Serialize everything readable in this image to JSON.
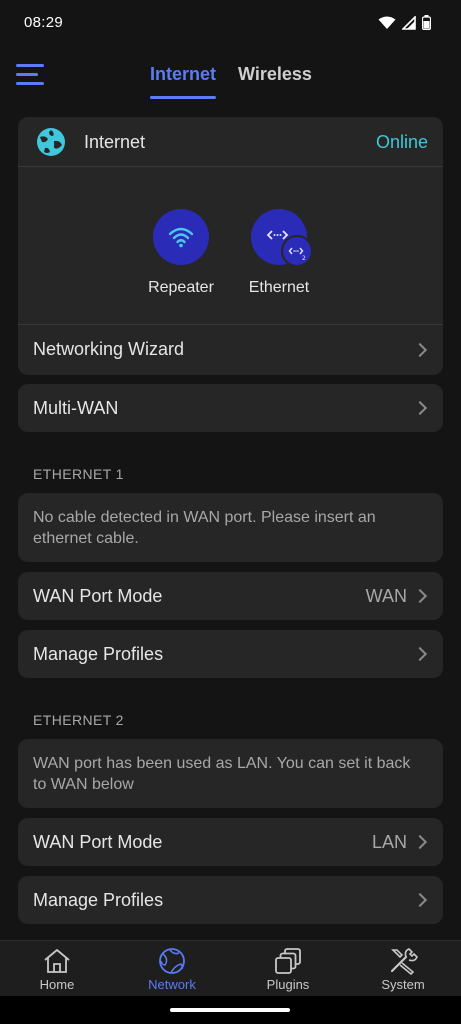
{
  "status_bar": {
    "time": "08:29",
    "icons": [
      "wifi-icon",
      "cellular-signal-icon",
      "battery-icon"
    ]
  },
  "header": {
    "tabs": [
      {
        "label": "Internet",
        "active": true
      },
      {
        "label": "Wireless",
        "active": false
      }
    ]
  },
  "internet_card": {
    "title": "Internet",
    "status": "Online",
    "status_color": "#3fc7dc",
    "modes": [
      {
        "label": "Repeater",
        "icon": "wifi-icon"
      },
      {
        "label": "Ethernet",
        "icon": "ethernet-icon",
        "badge": "2"
      }
    ],
    "networking_wizard": "Networking Wizard"
  },
  "multi_wan": {
    "label": "Multi-WAN"
  },
  "ethernet1": {
    "header": "ETHERNET 1",
    "note": "No cable detected in WAN port. Please insert an ethernet cable.",
    "wan_port_mode": {
      "label": "WAN Port Mode",
      "value": "WAN"
    },
    "manage_profiles": {
      "label": "Manage Profiles"
    }
  },
  "ethernet2": {
    "header": "ETHERNET 2",
    "note": "WAN port has been used as LAN. You can set it back to WAN below",
    "wan_port_mode": {
      "label": "WAN Port Mode",
      "value": "LAN"
    },
    "manage_profiles": {
      "label": "Manage Profiles"
    }
  },
  "bottom_nav": {
    "items": [
      {
        "label": "Home",
        "icon": "home-icon",
        "active": false
      },
      {
        "label": "Network",
        "icon": "globe-icon",
        "active": true
      },
      {
        "label": "Plugins",
        "icon": "plugins-icon",
        "active": false
      },
      {
        "label": "System",
        "icon": "tools-icon",
        "active": false
      }
    ]
  },
  "colors": {
    "accent": "#5b7cf4",
    "background": "#141414",
    "card": "#262626",
    "mode_circle": "#2a2bb6"
  }
}
